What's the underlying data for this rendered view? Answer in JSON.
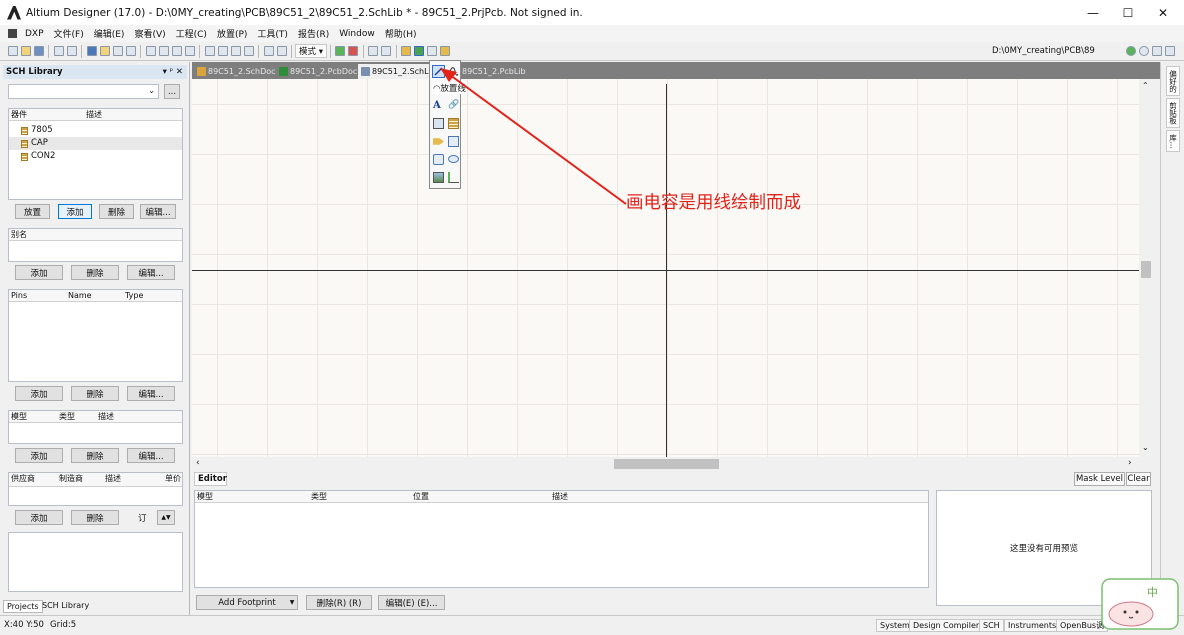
{
  "window": {
    "title": "Altium Designer (17.0) - D:\\0MY_creating\\PCB\\89C51_2\\89C51_2.SchLib * - 89C51_2.PrjPcb. Not signed in.",
    "minimize": "—",
    "maximize": "☐",
    "close": "✕"
  },
  "menu": [
    "DXP",
    "文件(F)",
    "编辑(E)",
    "察看(V)",
    "工程(C)",
    "放置(P)",
    "工具(T)",
    "报告(R)",
    "Window",
    "帮助(H)"
  ],
  "toolbar": {
    "mode_label": "模式 ▾",
    "path": "D:\\0MY_creating\\PCB\\89"
  },
  "sch_library": {
    "title": "SCH Library",
    "panel_controls": "▾ ᵖ ✕",
    "filter_btn": "...",
    "components_header": [
      "器件",
      "描述"
    ],
    "components": [
      "7805",
      "CAP",
      "CON2"
    ],
    "component_buttons": [
      "放置",
      "添加",
      "删除",
      "编辑..."
    ],
    "alias_header": "别名",
    "alias_buttons": [
      "添加",
      "删除",
      "编辑..."
    ],
    "pins_header": [
      "Pins",
      "Name",
      "Type"
    ],
    "pins_buttons": [
      "添加",
      "删除",
      "编辑..."
    ],
    "models_header": [
      "模型",
      "类型",
      "描述"
    ],
    "models_buttons": [
      "添加",
      "删除",
      "编辑..."
    ],
    "supplier_header": [
      "供应商",
      "制造商",
      "描述",
      "单价"
    ],
    "supplier_buttons": [
      "添加",
      "删除"
    ],
    "order_label": "订",
    "bottom_tabs": [
      "Projects",
      "SCH Library"
    ]
  },
  "doc_tabs": [
    "89C51_2.SchDoc",
    "89C51_2.PcbDoc",
    "89C51_2.SchLib",
    "89C51_2.PcbLib"
  ],
  "colors": {
    "tab_schdoc": "#d8a53c",
    "tab_pcbdoc": "#2f8c3a",
    "tab_schlib": "#7a8fb0",
    "tab_pcblib": "#6aa84f",
    "annotation": "#e2231a"
  },
  "dropdown": {
    "tooltip": "放置线",
    "tools": [
      "line",
      "bezier",
      "arc",
      "polygon",
      "text",
      "hyperlink",
      "text-frame",
      "component",
      "ieee-symbol",
      "pin",
      "rectangle",
      "ellipse",
      "graphic",
      "round-rect"
    ]
  },
  "annotation": "画电容是用线绘制而成",
  "right_tabs": [
    "偏好的",
    "剪贴板",
    "库..."
  ],
  "editor": {
    "tab": "Editor",
    "mask_level": "Mask Level",
    "clear": "Clear",
    "columns": [
      "模型",
      "类型",
      "位置",
      "描述"
    ],
    "preview_text": "这里没有可用预览",
    "add_footprint": "Add Footprint",
    "delete": "删除(R) (R)",
    "edit": "编辑(E) (E)..."
  },
  "status": {
    "coords": "X:40 Y:50",
    "grid": "Grid:5",
    "buttons": [
      "System",
      "Design Compiler",
      "SCH",
      "Instruments",
      "OpenBus调"
    ]
  }
}
